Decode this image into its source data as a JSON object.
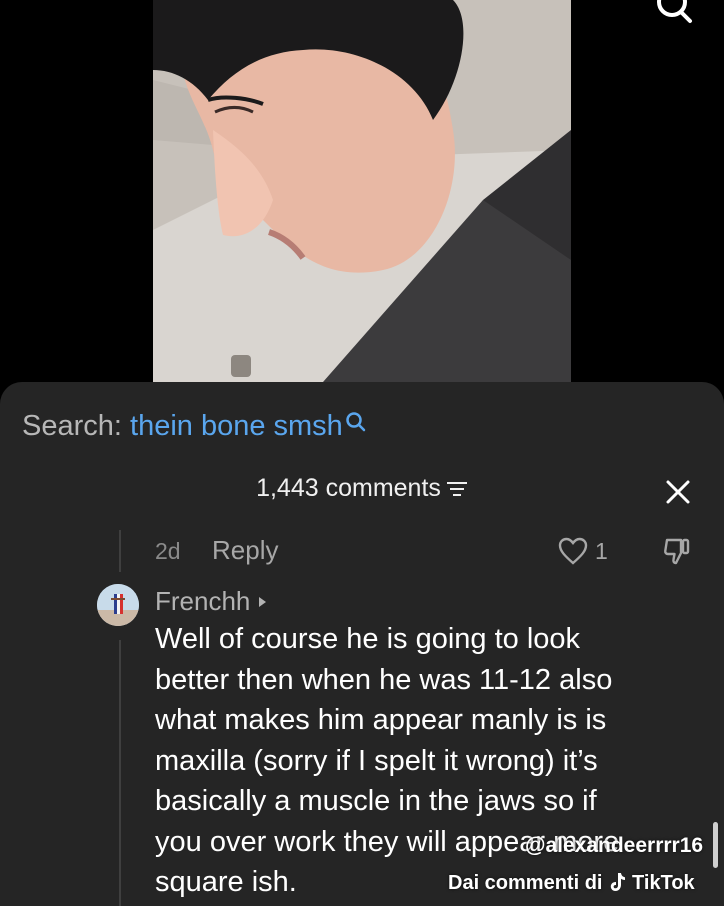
{
  "search_banner": {
    "prefix": "Search:",
    "query": "thein bone smsh",
    "query_color": "#5aa6ee"
  },
  "comments_header": {
    "count_label": "1,443 comments"
  },
  "reply_row": {
    "time": "2d",
    "reply_label": "Reply",
    "like_count": "1"
  },
  "comment": {
    "author": "Frenchh",
    "lines": [
      "Well of course he is going to look",
      "better then when he was 11-12 also",
      "what makes him appear manly is is",
      "maxilla (sorry if I spelt it wrong) it’s",
      "basically a muscle in the jaws so if",
      "you over work they will appear more",
      "square ish."
    ]
  },
  "watermark": {
    "handle": "@alexandeerrrr16",
    "source_prefix": "Dai commenti di",
    "brand": "TikTok"
  },
  "icons": {
    "top_search": "search-icon",
    "inline_search": "search-icon",
    "filter": "filter-icon",
    "close": "close-icon",
    "like": "heart-icon",
    "dislike": "thumbs-down-icon",
    "author_arrow": "triangle-right-icon",
    "brand": "tiktok-note-icon"
  }
}
